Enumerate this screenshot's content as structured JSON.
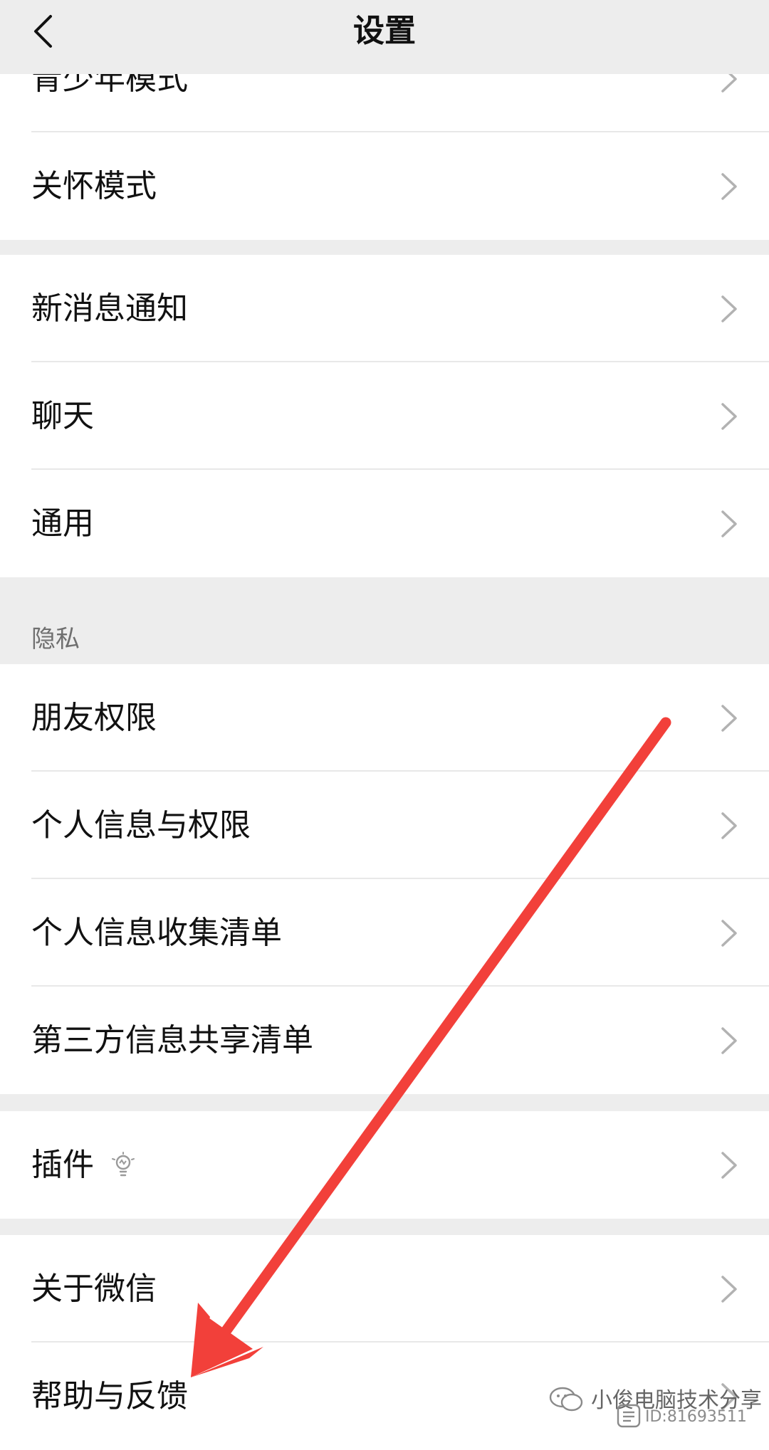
{
  "header": {
    "title": "设置",
    "back_icon": "chevron-left-icon"
  },
  "groups": [
    {
      "items": [
        {
          "label": "青少年模式"
        },
        {
          "label": "关怀模式"
        }
      ]
    },
    {
      "items": [
        {
          "label": "新消息通知"
        },
        {
          "label": "聊天"
        },
        {
          "label": "通用"
        }
      ]
    },
    {
      "header": "隐私",
      "items": [
        {
          "label": "朋友权限"
        },
        {
          "label": "个人信息与权限"
        },
        {
          "label": "个人信息收集清单"
        },
        {
          "label": "第三方信息共享清单"
        }
      ]
    },
    {
      "items": [
        {
          "label": "插件",
          "icon": "lightbulb-icon"
        }
      ]
    },
    {
      "items": [
        {
          "label": "关于微信"
        },
        {
          "label": "帮助与反馈"
        }
      ]
    }
  ],
  "watermark": {
    "text": "小俊电脑技术分享",
    "id": "ID:81693511"
  },
  "colors": {
    "background": "#ededed",
    "cell": "#ffffff",
    "arrow": "#f2403a",
    "chevron": "#b2b2b2"
  }
}
